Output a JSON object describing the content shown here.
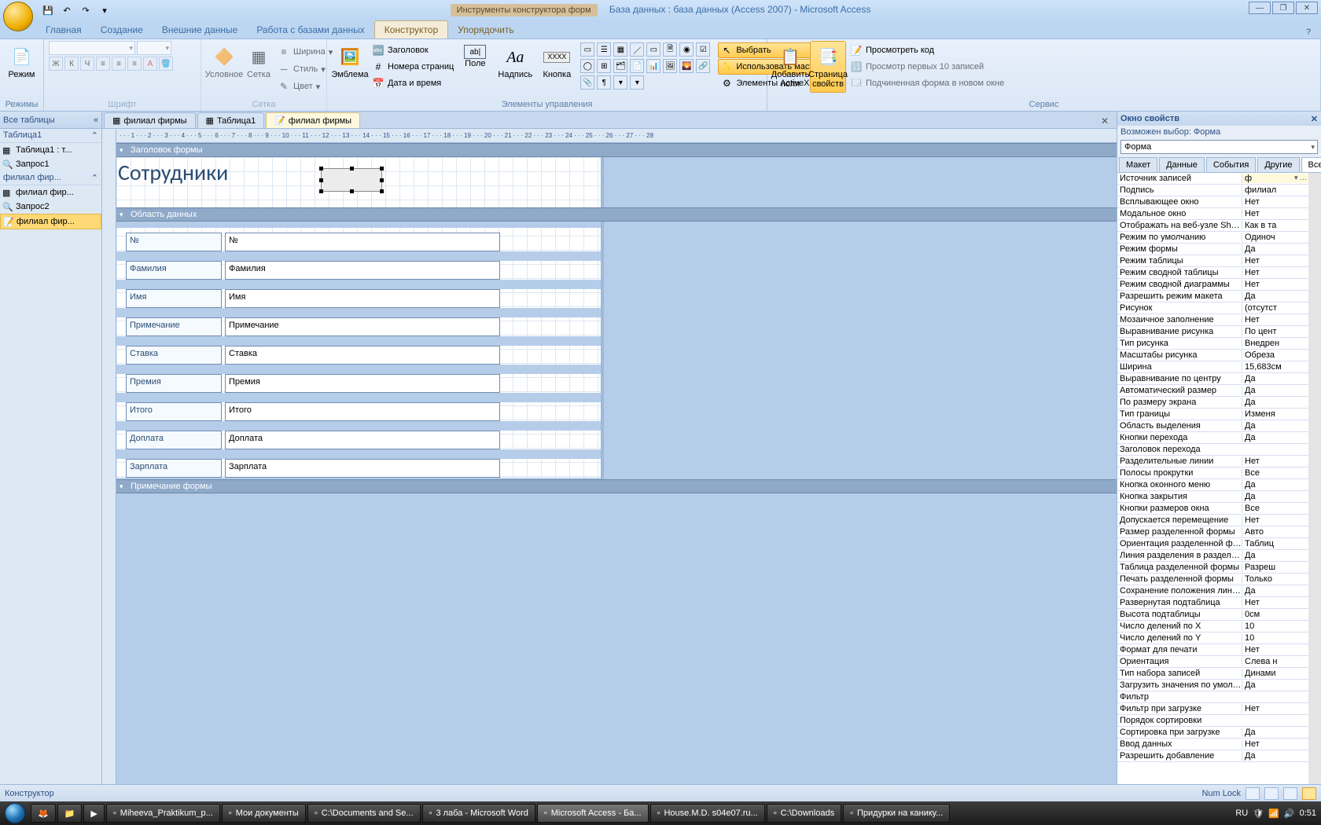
{
  "window": {
    "contextual_title": "Инструменты конструктора форм",
    "title": "База данных : база данных (Access 2007) - Microsoft Access"
  },
  "ribbon_tabs": {
    "home": "Главная",
    "create": "Создание",
    "external": "Внешние данные",
    "dbtools": "Работа с базами данных",
    "design": "Конструктор",
    "arrange": "Упорядочить"
  },
  "ribbon": {
    "views": {
      "btn": "Режим",
      "group": "Режимы"
    },
    "font": {
      "group": "Шрифт",
      "bold": "Ж",
      "italic": "К",
      "underline": "Ч"
    },
    "gridlines": {
      "group": "Сетка",
      "gridlines": "Сетка",
      "conditional": "Условное",
      "width": "Ширина",
      "style": "Стиль",
      "color": "Цвет"
    },
    "logo": {
      "btn": "Эмблема"
    },
    "headers": {
      "title": "Заголовок",
      "pagenum": "Номера страниц",
      "datetime": "Дата и время"
    },
    "controls": {
      "group": "Элементы управления",
      "textbox": "Поле",
      "label": "Надпись",
      "button": "Кнопка",
      "select": "Выбрать",
      "wizards": "Использовать мастера",
      "activex": "Элементы ActiveX"
    },
    "tools": {
      "addfields": "Добавить поля",
      "propsheet": "Страница свойств",
      "group": "Сервис",
      "viewcode": "Просмотреть код",
      "top100": "Просмотр первых 10 записей",
      "subform": "Подчиненная форма в новом окне"
    }
  },
  "nav": {
    "header": "Все таблицы",
    "g1": "Таблица1",
    "g1_i1": "Таблица1 : т...",
    "g1_i2": "Запрос1",
    "g2": "филиал фир...",
    "g2_i1": "филиал фир...",
    "g2_i2": "Запрос2",
    "g2_i3": "филиал фир..."
  },
  "doctabs": {
    "t1": "филиал фирмы",
    "t2": "Таблица1",
    "t3": "филиал фирмы"
  },
  "sections": {
    "header": "Заголовок формы",
    "detail": "Область данных",
    "footer": "Примечание формы"
  },
  "form": {
    "title": "Сотрудники",
    "fields": [
      {
        "label": "№",
        "ctrl": "№"
      },
      {
        "label": "Фамилия",
        "ctrl": "Фамилия"
      },
      {
        "label": "Имя",
        "ctrl": "Имя"
      },
      {
        "label": "Примечание",
        "ctrl": "Примечание"
      },
      {
        "label": "Ставка",
        "ctrl": "Ставка"
      },
      {
        "label": "Премия",
        "ctrl": "Премия"
      },
      {
        "label": "Итого",
        "ctrl": "Итого"
      },
      {
        "label": "Доплата",
        "ctrl": "Доплата"
      },
      {
        "label": "Зарплата",
        "ctrl": "Зарплата"
      }
    ]
  },
  "props": {
    "title": "Окно свойств",
    "subtitle": "Возможен выбор:  Форма",
    "combo": "Форма",
    "tabs": {
      "format": "Макет",
      "data": "Данные",
      "event": "События",
      "other": "Другие",
      "all": "Все"
    },
    "rows": [
      {
        "n": "Источник записей",
        "v": "ф"
      },
      {
        "n": "Подпись",
        "v": "филиал"
      },
      {
        "n": "Всплывающее окно",
        "v": "Нет"
      },
      {
        "n": "Модальное окно",
        "v": "Нет"
      },
      {
        "n": "Отображать на веб-узле SharePoint",
        "v": "Как в та"
      },
      {
        "n": "Режим по умолчанию",
        "v": "Одиноч"
      },
      {
        "n": "Режим формы",
        "v": "Да"
      },
      {
        "n": "Режим таблицы",
        "v": "Нет"
      },
      {
        "n": "Режим сводной таблицы",
        "v": "Нет"
      },
      {
        "n": "Режим сводной диаграммы",
        "v": "Нет"
      },
      {
        "n": "Разрешить режим макета",
        "v": "Да"
      },
      {
        "n": "Рисунок",
        "v": "(отсутст"
      },
      {
        "n": "Мозаичное заполнение",
        "v": "Нет"
      },
      {
        "n": "Выравнивание рисунка",
        "v": "По цент"
      },
      {
        "n": "Тип рисунка",
        "v": "Внедрен"
      },
      {
        "n": "Масштабы рисунка",
        "v": "Обреза"
      },
      {
        "n": "Ширина",
        "v": "15,683см"
      },
      {
        "n": "Выравнивание по центру",
        "v": "Да"
      },
      {
        "n": "Автоматический размер",
        "v": "Да"
      },
      {
        "n": "По размеру экрана",
        "v": "Да"
      },
      {
        "n": "Тип границы",
        "v": "Изменя"
      },
      {
        "n": "Область выделения",
        "v": "Да"
      },
      {
        "n": "Кнопки перехода",
        "v": "Да"
      },
      {
        "n": "Заголовок перехода",
        "v": ""
      },
      {
        "n": "Разделительные линии",
        "v": "Нет"
      },
      {
        "n": "Полосы прокрутки",
        "v": "Все"
      },
      {
        "n": "Кнопка оконного меню",
        "v": "Да"
      },
      {
        "n": "Кнопка закрытия",
        "v": "Да"
      },
      {
        "n": "Кнопки размеров окна",
        "v": "Все"
      },
      {
        "n": "Допускается перемещение",
        "v": "Нет"
      },
      {
        "n": "Размер разделенной формы",
        "v": "Авто"
      },
      {
        "n": "Ориентация разделенной формы",
        "v": "Таблиц"
      },
      {
        "n": "Линия разделения в разделенной ф",
        "v": "Да"
      },
      {
        "n": "Таблица разделенной формы",
        "v": "Разреш"
      },
      {
        "n": "Печать разделенной формы",
        "v": "Только"
      },
      {
        "n": "Сохранение положения линии раз",
        "v": "Да"
      },
      {
        "n": "Развернутая подтаблица",
        "v": "Нет"
      },
      {
        "n": "Высота подтаблицы",
        "v": "0см"
      },
      {
        "n": "Число делений по X",
        "v": "10"
      },
      {
        "n": "Число делений по Y",
        "v": "10"
      },
      {
        "n": "Формат для печати",
        "v": "Нет"
      },
      {
        "n": "Ориентация",
        "v": "Слева н"
      },
      {
        "n": "Тип набора записей",
        "v": "Динами"
      },
      {
        "n": "Загрузить значения по умолчанию",
        "v": "Да"
      },
      {
        "n": "Фильтр",
        "v": ""
      },
      {
        "n": "Фильтр при загрузке",
        "v": "Нет"
      },
      {
        "n": "Порядок сортировки",
        "v": ""
      },
      {
        "n": "Сортировка при загрузке",
        "v": "Да"
      },
      {
        "n": "Ввод данных",
        "v": "Нет"
      },
      {
        "n": "Разрешить добавление",
        "v": "Да"
      }
    ]
  },
  "status": {
    "mode": "Конструктор",
    "numlock": "Num Lock"
  },
  "taskbar": {
    "items": [
      "Miheeva_Praktikum_p...",
      "Мои документы",
      "C:\\Documents and Se...",
      "3 лаба - Microsoft Word",
      "Microsoft Access - Ба...",
      "House.M.D. s04e07.ru...",
      "C:\\Downloads",
      "Придурки на канику..."
    ],
    "clock": "0:51"
  }
}
